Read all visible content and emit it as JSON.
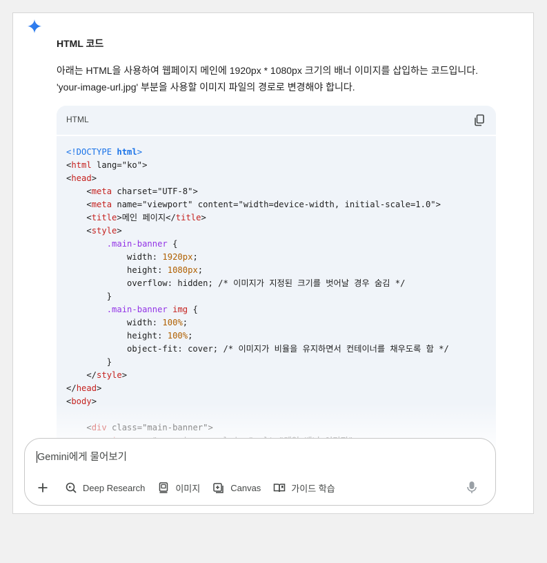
{
  "response": {
    "heading": "HTML 코드",
    "paragraph_lines": [
      "아래는 HTML을 사용하여 웹페이지 메인에 1920px * 1080px 크기의 배너 이미지를 삽입하는 코드입니다.",
      "'your-image-url.jpg' 부분을 사용할 이미지 파일의 경로로 변경해야 합니다."
    ]
  },
  "code_block": {
    "language": "HTML",
    "copy_icon": "copy-icon",
    "lines": [
      "<!DOCTYPE html>",
      "<html lang=\"ko\">",
      "<head>",
      "    <meta charset=\"UTF-8\">",
      "    <meta name=\"viewport\" content=\"width=device-width, initial-scale=1.0\">",
      "    <title>메인 페이지</title>",
      "    <style>",
      "        .main-banner {",
      "            width: 1920px;",
      "            height: 1080px;",
      "            overflow: hidden; /* 이미지가 지정된 크기를 벗어날 경우 숨김 */",
      "        }",
      "        .main-banner img {",
      "            width: 100%;",
      "            height: 100%;",
      "            object-fit: cover; /* 이미지가 비율을 유지하면서 컨테이너를 채우도록 함 */",
      "        }",
      "    </style>",
      "</head>",
      "<body>",
      "",
      "    <div class=\"main-banner\">",
      "        <img src=\"your-image-url.jpg\" alt=\"메인 배너 이미지\">"
    ]
  },
  "prompt_input": {
    "placeholder": "Gemini에게 물어보기",
    "value": ""
  },
  "toolbar": {
    "add_icon": "plus-icon",
    "tools": [
      {
        "label": "Deep Research",
        "icon": "deep-research-icon"
      },
      {
        "label": "이미지",
        "icon": "image-icon"
      },
      {
        "label": "Canvas",
        "icon": "canvas-icon"
      },
      {
        "label": "가이드 학습",
        "icon": "guided-learning-icon"
      }
    ],
    "mic_icon": "microphone-icon"
  },
  "colors": {
    "accent_blue": "#1a73e8",
    "code_background": "#f0f4f9",
    "tag_red": "#c5221f",
    "attr_orange": "#b06000",
    "string_green": "#188038",
    "selector_purple": "#9334e6"
  }
}
